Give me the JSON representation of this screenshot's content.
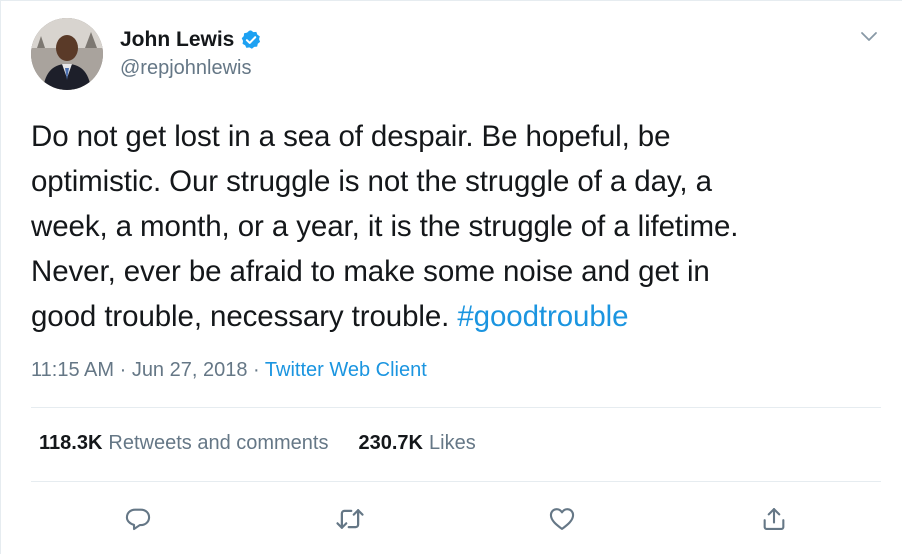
{
  "author": {
    "name": "John Lewis",
    "handle": "@repjohnlewis",
    "verified": true
  },
  "tweet": {
    "lines": [
      "Do not get lost in a sea of despair. Be hopeful, be",
      "optimistic. Our struggle is not the struggle of a day, a",
      "week, a month, or a year, it is the struggle of a lifetime.",
      "Never, ever be afraid to make some noise and get in",
      "good trouble, necessary trouble. "
    ],
    "hashtag": "#goodtrouble"
  },
  "meta": {
    "time": "11:15 AM",
    "sep1": " · ",
    "date": "Jun 27, 2018",
    "sep2": " · ",
    "source": "Twitter Web Client"
  },
  "stats": {
    "retweets_count": "118.3K",
    "retweets_label": "Retweets and comments",
    "likes_count": "230.7K",
    "likes_label": "Likes"
  },
  "icons": {
    "menu": "chevron-down-icon",
    "reply": "reply-icon",
    "retweet": "retweet-icon",
    "like": "heart-icon",
    "share": "share-icon"
  },
  "colors": {
    "link": "#1b95e0",
    "secondary_text": "#657786",
    "verified_badge": "#1da1f2"
  }
}
